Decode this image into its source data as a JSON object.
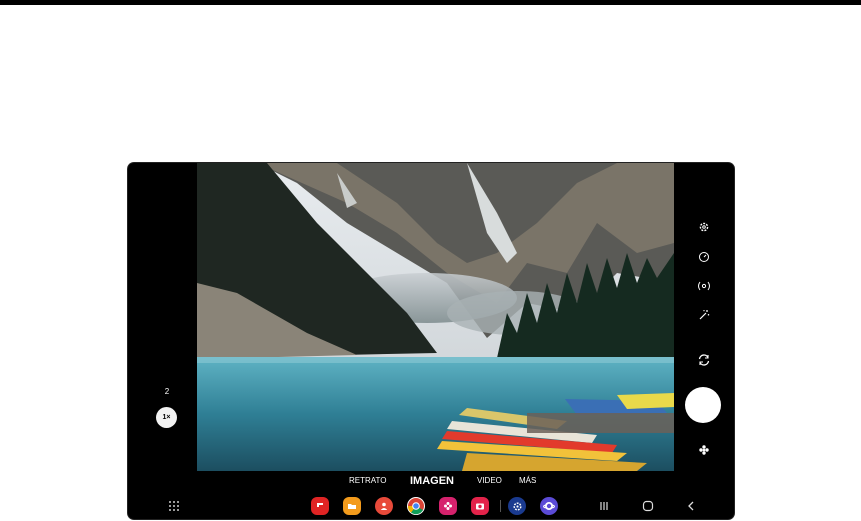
{
  "camera": {
    "zoom_options": [
      "2",
      "1×"
    ],
    "modes": [
      "RETRATO",
      "IMAGEN",
      "VIDEO",
      "MÁS"
    ],
    "active_mode": "IMAGEN",
    "right_controls": [
      "settings-icon",
      "timer-icon",
      "motion-photo-icon",
      "filters-icon",
      "switch-camera-icon",
      "shutter-button",
      "bixby-vision-icon"
    ]
  },
  "taskbar": {
    "apps": [
      "app-drawer-icon",
      "flipboard-icon",
      "my-files-icon",
      "contacts-icon",
      "chrome-icon",
      "gallery-icon",
      "camera-icon",
      "settings-icon",
      "internet-icon"
    ],
    "nav": [
      "recents-icon",
      "home-icon",
      "back-icon"
    ]
  },
  "colors": {
    "background": "#ffffff",
    "device": "#000000",
    "shutter": "#ffffff",
    "active_mode": "#ffffff"
  }
}
